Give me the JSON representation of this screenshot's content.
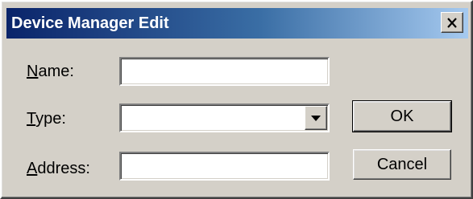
{
  "window": {
    "title": "Device Manager Edit",
    "close_icon": "close-x-icon"
  },
  "form": {
    "name": {
      "label_mnemonic": "N",
      "label_rest": "ame:",
      "value": ""
    },
    "type": {
      "label_mnemonic": "T",
      "label_rest": "ype:",
      "selected": "",
      "dropdown_icon": "chevron-down-icon"
    },
    "address": {
      "label_mnemonic": "A",
      "label_rest": "ddress:",
      "value": ""
    }
  },
  "buttons": {
    "ok_label": "OK",
    "cancel_label": "Cancel"
  },
  "colors": {
    "titlebar_start": "#0a246a",
    "titlebar_end": "#a6caf0",
    "face": "#d4d0c8"
  }
}
